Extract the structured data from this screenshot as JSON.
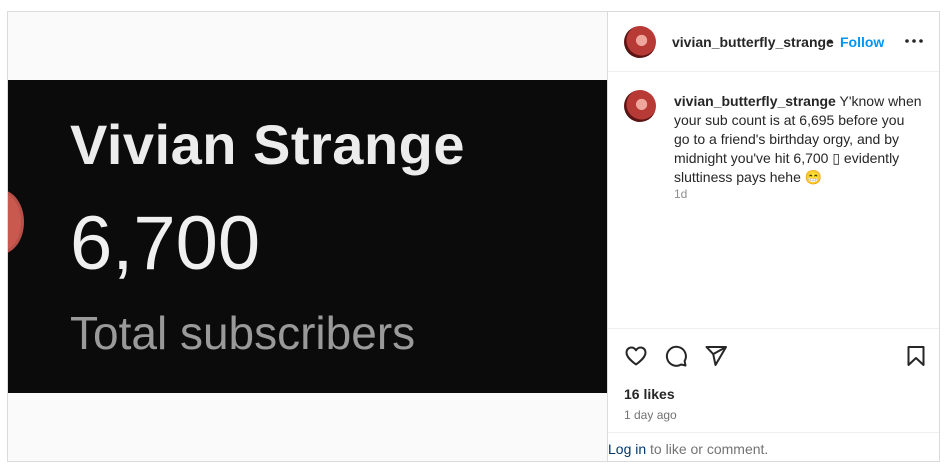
{
  "media": {
    "name": "Vivian Strange",
    "count": "6,700",
    "label": "Total subscribers"
  },
  "header": {
    "username": "vivian_butterfly_strange",
    "separator": "•",
    "follow": "Follow",
    "more_icon": "more-horizontal-icon"
  },
  "comment": {
    "username": "vivian_butterfly_strange",
    "text": "Y'know when your sub count is at 6,695 before you go to a friend's birthday orgy, and by midnight you've hit 6,700 ▯ evidently sluttiness pays hehe 😁",
    "age": "1d"
  },
  "actions": {
    "icons": [
      "heart-icon",
      "comment-icon",
      "share-icon",
      "bookmark-icon"
    ],
    "likes": "16 likes",
    "time": "1 day ago"
  },
  "login": {
    "link": "Log in",
    "text": " to like or comment."
  },
  "colors": {
    "follow": "#0095f6",
    "login_link": "#00376b",
    "media_bg": "#0b0b0b"
  }
}
